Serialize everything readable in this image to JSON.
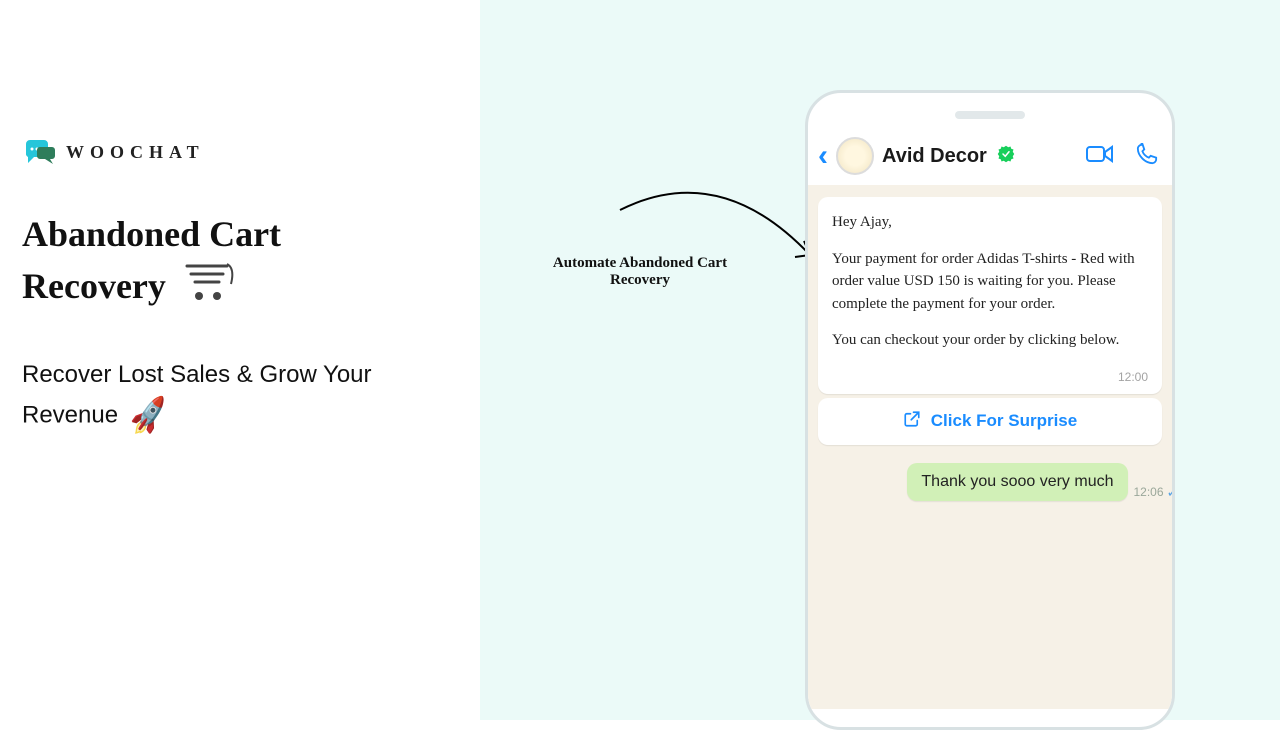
{
  "brand": {
    "name": "WOOCHAT"
  },
  "headline": {
    "line1": "Abandoned Cart",
    "line2": "Recovery"
  },
  "subheadline": "Recover Lost Sales & Grow Your Revenue",
  "arrow_label": "Automate Abandoned Cart Recovery",
  "chat": {
    "contact": "Avid Decor",
    "incoming": {
      "greeting": "Hey Ajay,",
      "body": "Your payment for order Adidas T-shirts - Red with order value USD 150 is waiting for you. Please complete the payment for your order.",
      "footer": "You can checkout your order by clicking below.",
      "time": "12:00"
    },
    "action": "Click For Surprise",
    "outgoing": {
      "text": "Thank you sooo very much",
      "time": "12:06"
    }
  }
}
